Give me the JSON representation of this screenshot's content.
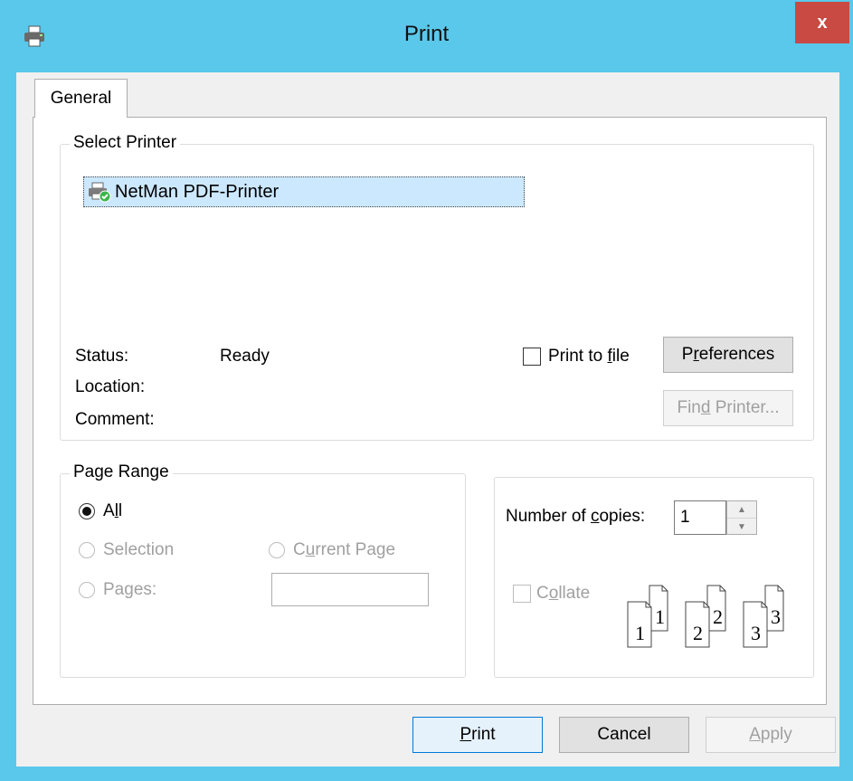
{
  "window": {
    "title": "Print",
    "close_glyph": "x",
    "icon": "printer-icon"
  },
  "tabs": [
    {
      "label": "General",
      "active": true
    }
  ],
  "select_printer": {
    "legend": "Select Printer",
    "printers": [
      {
        "name": "NetMan PDF-Printer",
        "selected": true,
        "icon": "printer-default-icon"
      }
    ],
    "status_label": "Status:",
    "status_value": "Ready",
    "location_label": "Location:",
    "location_value": "",
    "comment_label": "Comment:",
    "comment_value": "",
    "print_to_file": {
      "label_pre": "Print to ",
      "label_key": "f",
      "label_post": "ile",
      "checked": false
    },
    "preferences": {
      "label_pre": "P",
      "label_key": "r",
      "label_post": "eferences"
    },
    "find_printer": {
      "label_pre": "Fin",
      "label_key": "d",
      "label_post": " Printer...",
      "enabled": false
    }
  },
  "page_range": {
    "legend": "Page Range",
    "all": {
      "label_pre": "A",
      "label_key": "l",
      "label_post": "l",
      "selected": true
    },
    "selection": {
      "label": "Selection",
      "enabled": false
    },
    "current_page": {
      "label_pre": "C",
      "label_key": "u",
      "label_post": "rrent Page",
      "enabled": false
    },
    "pages": {
      "label_pre": "Pa",
      "label_key": "g",
      "label_post": "es:",
      "enabled": false,
      "value": ""
    }
  },
  "copies": {
    "label_pre": "Number of ",
    "label_key": "c",
    "label_post": "opies:",
    "value": "1",
    "collate": {
      "label_pre": "C",
      "label_key": "o",
      "label_post": "llate",
      "checked": false,
      "enabled": false
    },
    "illustration_numbers": [
      "1",
      "1",
      "2",
      "2",
      "3",
      "3"
    ]
  },
  "buttons": {
    "print": {
      "label_key": "P",
      "label_post": "rint"
    },
    "cancel": {
      "label": "Cancel"
    },
    "apply": {
      "label_key": "A",
      "label_post": "pply",
      "enabled": false
    }
  },
  "colors": {
    "titlebar": "#5ac8eb",
    "close_button": "#c84a42",
    "selection_highlight": "#cce8ff",
    "default_button_border": "#0078d7"
  }
}
